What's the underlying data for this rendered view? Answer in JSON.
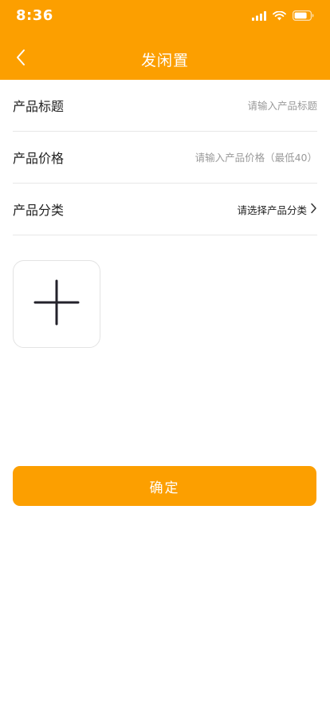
{
  "status_bar": {
    "time": "8:36",
    "icons": [
      "signal-icon",
      "wifi-icon",
      "battery-icon"
    ]
  },
  "nav": {
    "back_icon": "chevron-left-icon",
    "title": "发闲置"
  },
  "form": {
    "title": {
      "label": "产品标题",
      "placeholder": "请输入产品标题"
    },
    "price": {
      "label": "产品价格",
      "placeholder": "请输入产品价格（最低40）"
    },
    "category": {
      "label": "产品分类",
      "select_text": "请选择产品分类",
      "icon": "chevron-right-icon"
    }
  },
  "upload": {
    "icon": "plus-icon"
  },
  "confirm_label": "确定",
  "colors": {
    "primary": "#fc9f00",
    "text": "#222222",
    "placeholder": "#9a9a9a",
    "divider": "#e7e7e7"
  }
}
